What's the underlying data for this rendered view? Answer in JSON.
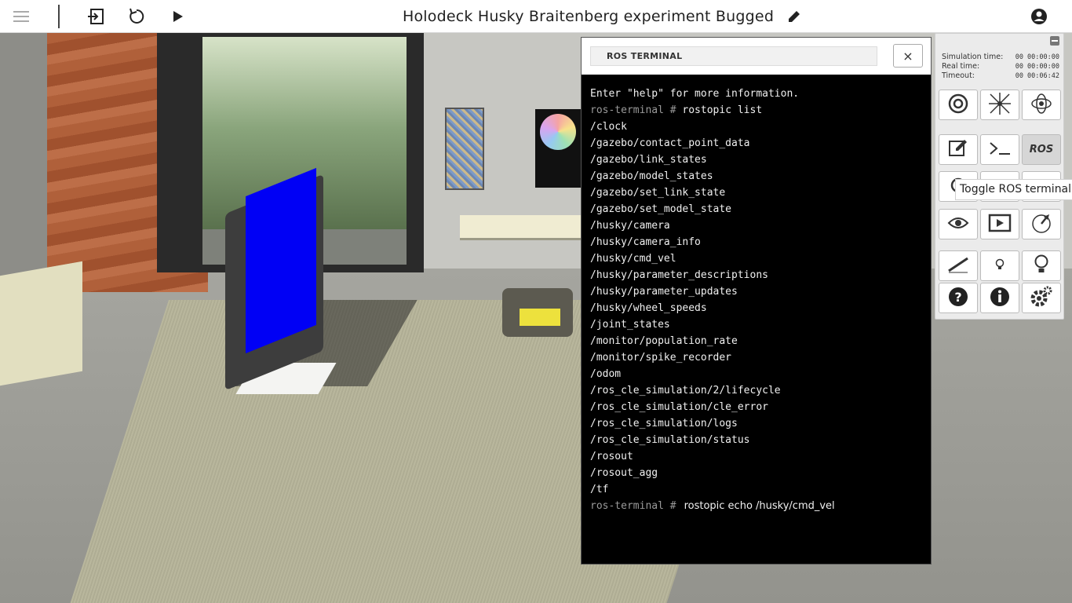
{
  "topbar": {
    "title": "Holodeck Husky Braitenberg experiment Bugged",
    "icons": [
      "menu-icon",
      "exit-icon",
      "reset-icon",
      "play-icon",
      "edit-icon",
      "account-icon"
    ]
  },
  "terminal": {
    "title": "ROS TERMINAL",
    "close_label": "×",
    "prompt": "ros-terminal #",
    "help_line": "Enter \"help\" for more information.",
    "first_command": "rostopic list",
    "topics": [
      "/clock",
      "/gazebo/contact_point_data",
      "/gazebo/link_states",
      "/gazebo/model_states",
      "/gazebo/set_link_state",
      "/gazebo/set_model_state",
      "/husky/camera",
      "/husky/camera_info",
      "/husky/cmd_vel",
      "/husky/parameter_descriptions",
      "/husky/parameter_updates",
      "/husky/wheel_speeds",
      "/joint_states",
      "/monitor/population_rate",
      "/monitor/spike_recorder",
      "/odom",
      "/ros_cle_simulation/2/lifecycle",
      "/ros_cle_simulation/cle_error",
      "/ros_cle_simulation/logs",
      "/ros_cle_simulation/status",
      "/rosout",
      "/rosout_agg",
      "/tf"
    ],
    "current_input": "rostopic echo /husky/cmd_vel"
  },
  "sidepanel": {
    "times": [
      {
        "label": "Simulation time:",
        "value": "00 00:00:00"
      },
      {
        "label": "Real time:",
        "value": "00 00:00:00"
      },
      {
        "label": "Timeout:",
        "value": "00 00:06:42"
      }
    ],
    "ros_button_label": "ROS",
    "tooltip": "Toggle ROS terminal"
  },
  "colors": {
    "terminal_bg": "#000000",
    "prompt": "#9a9a9a",
    "panel_bg": "#ebebeb"
  }
}
